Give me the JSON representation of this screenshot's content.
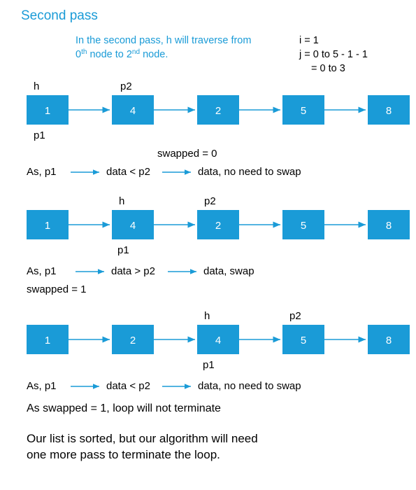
{
  "title": "Second pass",
  "intro_line1": "In the second pass, h will traverse from",
  "intro_line2": "0",
  "intro_line2_th": "th",
  "intro_line2_rest": " node to 2",
  "intro_line2_nd": "nd",
  "intro_line2_end": " node.",
  "iter_i": "i = 1",
  "iter_j1": "j = 0  to  5 - 1 - 1",
  "iter_j2": "= 0 to 3",
  "labels": {
    "h": "h",
    "p1": "p1",
    "p2": "p2"
  },
  "step1": {
    "nodes": [
      "1",
      "4",
      "2",
      "5",
      "8"
    ],
    "note_swapped": "swapped = 0",
    "as_prefix": "As,   p1",
    "cmp_mid": "data < p2",
    "cmp_end": "data,  no need to swap"
  },
  "step2": {
    "nodes": [
      "1",
      "4",
      "2",
      "5",
      "8"
    ],
    "as_prefix": "As,    p1",
    "cmp_mid": "data > p2",
    "cmp_end": "data,  swap",
    "swapped_line": "swapped  =  1"
  },
  "step3": {
    "nodes": [
      "1",
      "2",
      "4",
      "5",
      "8"
    ],
    "as_prefix": "As,   p1",
    "cmp_mid": "data < p2",
    "cmp_end": "data,  no need to swap",
    "conclusion": "As swapped  =  1,  loop will not terminate"
  },
  "final_line1": "Our list is sorted, but our algorithm will need",
  "final_line2": "one more pass to terminate the loop.",
  "chart_data": {
    "type": "diagram",
    "structure": "singly-linked-list bubble-sort pass",
    "pass_index": 2,
    "i": 1,
    "j_range": [
      0,
      3
    ],
    "iterations": [
      {
        "h_index": 0,
        "p1_index": 0,
        "p2_index": 1,
        "list": [
          1,
          4,
          2,
          5,
          8
        ],
        "comparison": "p1.data < p2.data",
        "action": "no swap",
        "swapped_before": 0
      },
      {
        "h_index": 1,
        "p1_index": 1,
        "p2_index": 2,
        "list": [
          1,
          4,
          2,
          5,
          8
        ],
        "comparison": "p1.data > p2.data",
        "action": "swap",
        "swapped_after": 1
      },
      {
        "h_index": 2,
        "p1_index": 2,
        "p2_index": 3,
        "list": [
          1,
          2,
          4,
          5,
          8
        ],
        "comparison": "p1.data < p2.data",
        "action": "no swap"
      }
    ],
    "final_swapped": 1,
    "loop_terminates": false,
    "note": "list is sorted but one more pass needed"
  }
}
